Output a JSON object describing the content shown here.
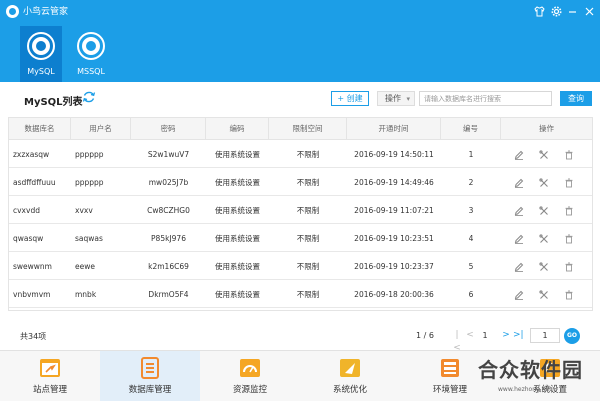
{
  "window": {
    "title": "小鸟云管家",
    "colors": {
      "header": "#1c9ee7",
      "tab_active": "#0d7fcf",
      "accent": "#1c9ee7"
    }
  },
  "db_tabs": [
    {
      "label": "MySQL",
      "icon": "dolphin-icon",
      "active": true
    },
    {
      "label": "MSSQL",
      "icon": "sqlserver-icon",
      "active": false
    }
  ],
  "toolbar": {
    "title": "MySQL列表",
    "create_label": "+ 创建",
    "operate_label": "操作",
    "search_placeholder": "请输入数据库名进行搜索",
    "search_label": "查询"
  },
  "table": {
    "columns": [
      "数据库名",
      "用户名",
      "密码",
      "编码",
      "限制空间",
      "开通时间",
      "编号",
      "操作"
    ],
    "rows": [
      {
        "db": "zxzxasqw",
        "user": "pppppp",
        "password": "S2w1wuV7",
        "encoding": "使用系统设置",
        "limit": "不限制",
        "time": "2016-09-19 14:50:11",
        "id": "1"
      },
      {
        "db": "asdffdffuuu",
        "user": "pppppp",
        "password": "mw025J7b",
        "encoding": "使用系统设置",
        "limit": "不限制",
        "time": "2016-09-19 14:49:46",
        "id": "2"
      },
      {
        "db": "cvxvdd",
        "user": "xvxv",
        "password": "Cw8CZHG0",
        "encoding": "使用系统设置",
        "limit": "不限制",
        "time": "2016-09-19 11:07:21",
        "id": "3"
      },
      {
        "db": "qwasqw",
        "user": "saqwas",
        "password": "P85kJ976",
        "encoding": "使用系统设置",
        "limit": "不限制",
        "time": "2016-09-19 10:23:51",
        "id": "4"
      },
      {
        "db": "swewwnm",
        "user": "eewe",
        "password": "k2m16C69",
        "encoding": "使用系统设置",
        "limit": "不限制",
        "time": "2016-09-19 10:23:37",
        "id": "5"
      },
      {
        "db": "vnbvmvm",
        "user": "mnbk",
        "password": "DkrmO5F4",
        "encoding": "使用系统设置",
        "limit": "不限制",
        "time": "2016-09-18 20:00:36",
        "id": "6"
      }
    ]
  },
  "pagination": {
    "total": "共34项",
    "pages": "1 / 6",
    "current": "1",
    "goto_value": "1",
    "go_label": "GO"
  },
  "bottom_nav": [
    {
      "label": "站点管理",
      "icon": "site-icon",
      "color": "#f5a623",
      "active": false
    },
    {
      "label": "数据库管理",
      "icon": "database-icon",
      "color": "#f28a2e",
      "active": true
    },
    {
      "label": "资源监控",
      "icon": "gauge-icon",
      "color": "#f5a623",
      "active": false
    },
    {
      "label": "系统优化",
      "icon": "optimize-icon",
      "color": "#f0b42a",
      "active": false
    },
    {
      "label": "环境管理",
      "icon": "environment-icon",
      "color": "#f28a2e",
      "active": false
    },
    {
      "label": "系统设置",
      "icon": "settings-icon",
      "color": "#f5a623",
      "active": false
    }
  ],
  "watermark": {
    "text": "合众软件园",
    "url": "www.hezhong.net"
  }
}
